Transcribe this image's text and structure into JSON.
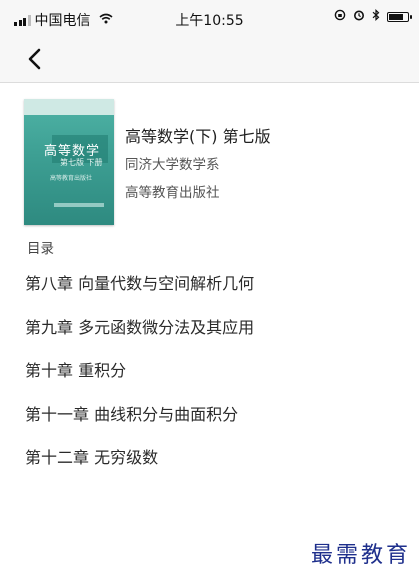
{
  "status_bar": {
    "carrier": "中国电信",
    "time": "上午10:55",
    "signal_icon": "signal-bars-icon",
    "wifi_icon": "wifi-icon",
    "rotation_lock_icon": "rotation-lock-icon",
    "alarm_icon": "alarm-icon",
    "bluetooth_icon": "bluetooth-icon",
    "battery_icon": "battery-icon"
  },
  "nav": {
    "back_icon": "chevron-left-icon"
  },
  "book": {
    "title": "高等数学(下) 第七版",
    "author": "同济大学数学系",
    "publisher": "高等教育出版社",
    "cover": {
      "title": "高等数学",
      "edition": "第七版  下册",
      "publisher": "高等教育出版社"
    }
  },
  "toc": {
    "heading": "目录",
    "chapters": [
      "第八章  向量代数与空间解析几何",
      "第九章  多元函数微分法及其应用",
      "第十章  重积分",
      "第十一章  曲线积分与曲面积分",
      "第十二章  无穷级数"
    ]
  },
  "watermark": "最需教育",
  "colors": {
    "cover_teal": "#3d9f93",
    "watermark": "#1e2f8c",
    "nav_background": "#f7f7f7"
  }
}
